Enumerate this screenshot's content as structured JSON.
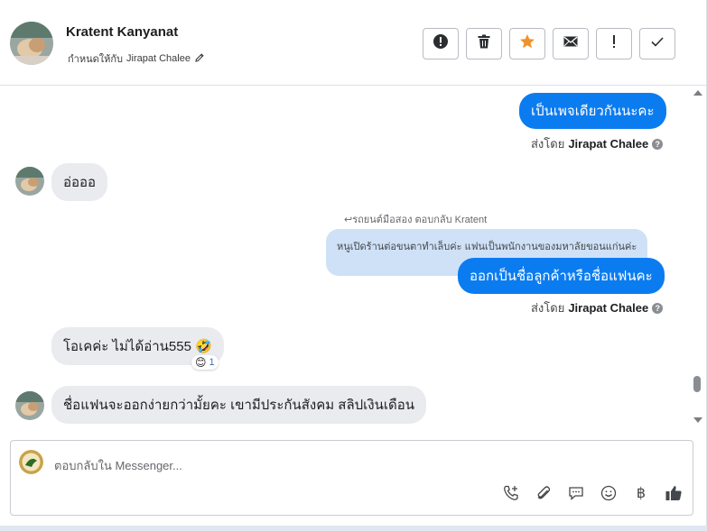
{
  "header": {
    "contact_name": "Kratent Kanyanat",
    "assign_prefix": "กำหนดให้กับ",
    "assignee": "Jirapat Chalee",
    "actions": [
      {
        "name": "spam",
        "icon": "alert-circle-icon"
      },
      {
        "name": "delete",
        "icon": "trash-icon"
      },
      {
        "name": "star",
        "icon": "star-icon"
      },
      {
        "name": "mail",
        "icon": "envelope-icon"
      },
      {
        "name": "follow-up",
        "icon": "exclamation-icon"
      },
      {
        "name": "done",
        "icon": "checkmark-icon"
      }
    ]
  },
  "messages": [
    {
      "direction": "out",
      "text": "เป็นเพจเดียวกันนะคะ",
      "sent_by_prefix": "ส่งโดย",
      "sent_by": "Jirapat Chalee"
    },
    {
      "direction": "in",
      "text": "อ่อออ"
    },
    {
      "direction": "out",
      "reply_meta": "รถยนต์มือสอง ตอบกลับ Kratent",
      "quoted": "หนูเปิดร้านต่อขนตาทำเล็บค่ะ แฟนเป็นพนักงานของมหาลัยขอนแก่นค่ะ",
      "text": "ออกเป็นชื่อลูกค้าหรือชื่อแฟนคะ",
      "sent_by_prefix": "ส่งโดย",
      "sent_by": "Jirapat Chalee"
    },
    {
      "direction": "in",
      "text": "โอเคค่ะ ไม่ได้อ่าน555 🤣",
      "reaction_emoji": "😊",
      "reaction_count": "1"
    },
    {
      "direction": "in",
      "text": "ชื่อแฟนจะออกง่ายกว่ามั้ยคะ เขามีประกันสังคม สลิปเงินเดือน"
    }
  ],
  "composer": {
    "placeholder": "ตอบกลับใน Messenger...",
    "tools": [
      "phone-plus-icon",
      "paperclip-icon",
      "chat-bubble-icon",
      "smiley-icon",
      "baht-icon",
      "thumbs-up-icon"
    ],
    "baht_symbol": "฿"
  },
  "colors": {
    "accent": "#0b7cf0",
    "quoted_bg": "#cfe1f7",
    "incoming_bg": "#e9ebee",
    "star": "#f0922b"
  }
}
